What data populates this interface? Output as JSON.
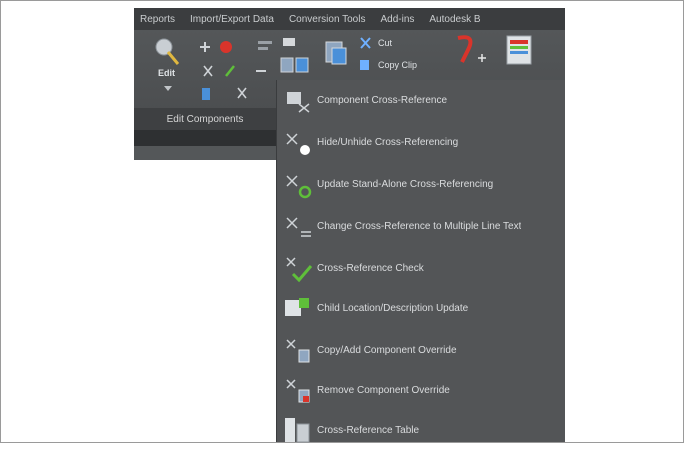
{
  "ribbon_tabs": [
    "Reports",
    "Import/Export Data",
    "Conversion Tools",
    "Add-ins",
    "Autodesk B"
  ],
  "ribbon": {
    "edit_label": "Edit",
    "cut_label": "Cut",
    "copy_clip_label": "Copy Clip",
    "panel_label": "Edit Components"
  },
  "menu": {
    "items": [
      {
        "label": "Component Cross-Reference",
        "icon": "component-xref-icon"
      },
      {
        "label": "Hide/Unhide Cross-Referencing",
        "icon": "hide-xref-icon"
      },
      {
        "label": "Update Stand-Alone Cross-Referencing",
        "icon": "update-xref-icon"
      },
      {
        "label": "Change Cross-Reference to Multiple Line Text",
        "icon": "multiline-xref-icon"
      },
      {
        "label": "Cross-Reference Check",
        "icon": "check-icon"
      },
      {
        "label": "Child Location/Description Update",
        "icon": "child-update-icon"
      },
      {
        "label": "Copy/Add Component Override",
        "icon": "copy-override-icon"
      },
      {
        "label": "Remove Component Override",
        "icon": "remove-override-icon"
      },
      {
        "label": "Cross-Reference Table",
        "icon": "xref-table-icon"
      }
    ]
  },
  "colors": {
    "ribbon_bg": "#545759",
    "menu_bg": "#535557",
    "menu_text": "#dadcde",
    "accent_green": "#5fbf3a",
    "accent_red": "#d9342b",
    "accent_blue": "#4a90d9"
  }
}
